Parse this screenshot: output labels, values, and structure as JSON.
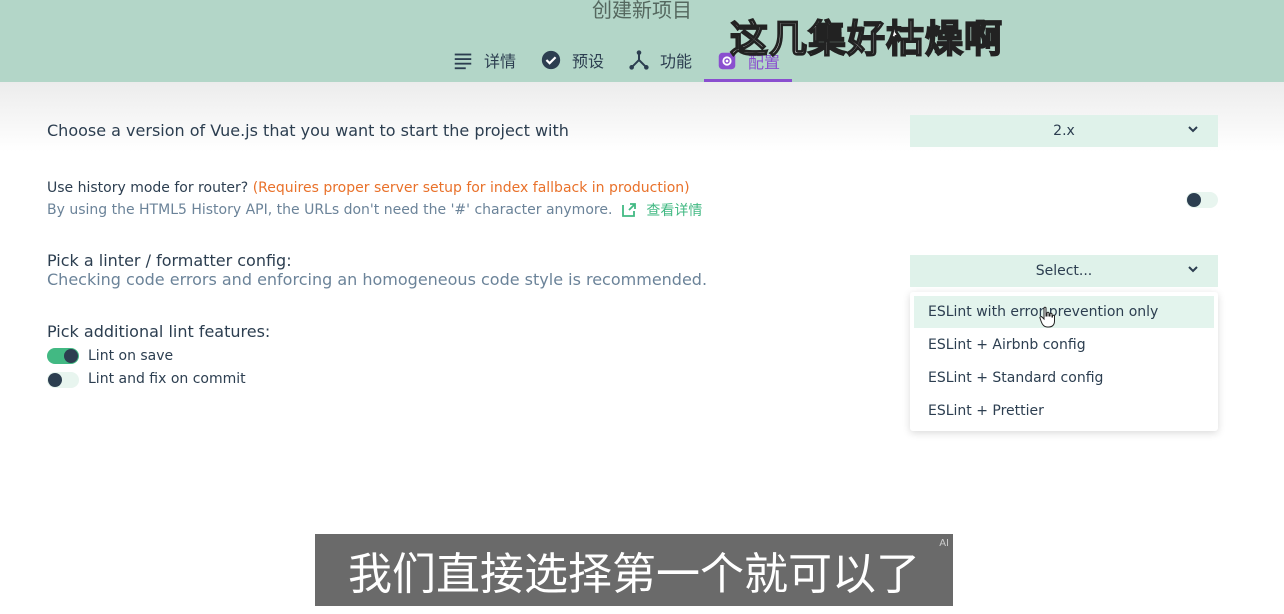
{
  "header": {
    "title": "创建新项目",
    "tabs": [
      {
        "label": "详情",
        "icon": "list-icon",
        "active": false
      },
      {
        "label": "预设",
        "icon": "check-circle-icon",
        "active": false
      },
      {
        "label": "功能",
        "icon": "tree-icon",
        "active": false
      },
      {
        "label": "配置",
        "icon": "gear-icon",
        "active": true
      }
    ]
  },
  "vue_version": {
    "label": "Choose a version of Vue.js that you want to start the project with",
    "selected": "2.x"
  },
  "history_mode": {
    "label": "Use history mode for router?",
    "note": "(Requires proper server setup for index fallback in production)",
    "desc": "By using the HTML5 History API, the URLs don't need the '#' character anymore.",
    "link": "查看详情",
    "enabled": false
  },
  "linter": {
    "label": "Pick a linter / formatter config:",
    "desc": "Checking code errors and enforcing an homogeneous code style is recommended.",
    "selected": "Select...",
    "options": [
      "ESLint with error prevention only",
      "ESLint + Airbnb config",
      "ESLint + Standard config",
      "ESLint + Prettier"
    ]
  },
  "lint_features": {
    "label": "Pick additional lint features:",
    "items": [
      {
        "label": "Lint on save",
        "enabled": true
      },
      {
        "label": "Lint and fix on commit",
        "enabled": false
      }
    ]
  },
  "overlay": {
    "top_caption": "这几集好枯燥啊",
    "subtitle": "我们直接选择第一个就可以了",
    "ai_mark": "AI"
  },
  "colors": {
    "accent": "#42b983",
    "active_tab": "#8a4fcf",
    "header_bg": "#b3d6c8",
    "warning": "#e9712a"
  }
}
